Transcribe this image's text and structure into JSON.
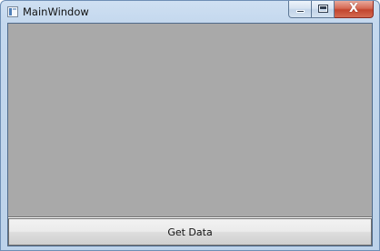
{
  "window": {
    "title": "MainWindow",
    "icon": "app-window-icon"
  },
  "caption_buttons": {
    "minimize_icon": "minimize-icon",
    "maximize_icon": "maximize-icon",
    "close_icon": "close-icon",
    "close_glyph": "X"
  },
  "content": {
    "panel_color": "#a9a9a9",
    "get_data_label": "Get Data"
  }
}
